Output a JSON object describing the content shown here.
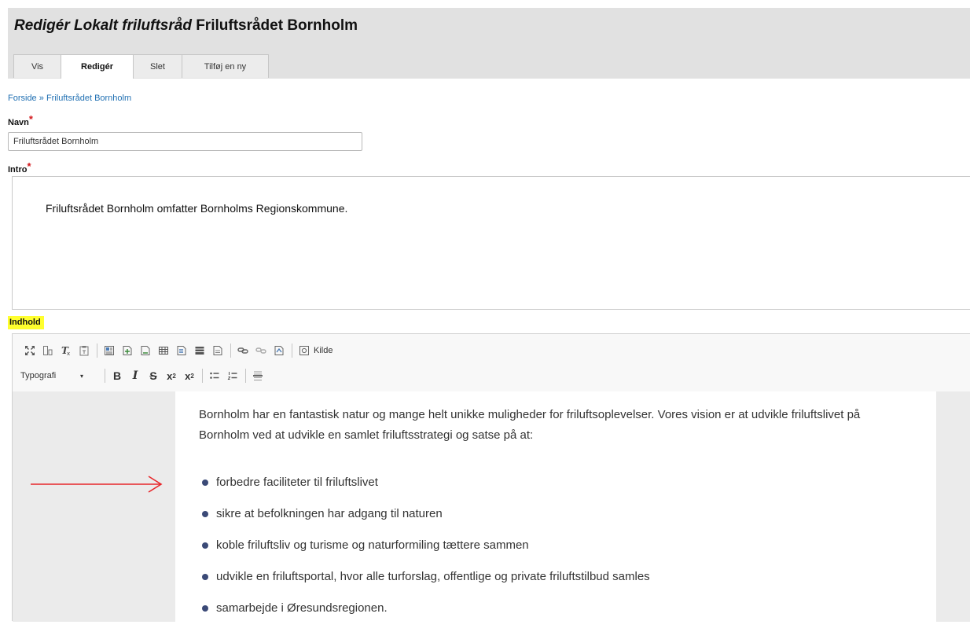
{
  "header": {
    "title_em": "Redigér Lokalt friluftsråd",
    "title_name": "Friluftsrådet Bornholm"
  },
  "tabs": [
    {
      "label": "Vis",
      "active": false
    },
    {
      "label": "Redigér",
      "active": true
    },
    {
      "label": "Slet",
      "active": false
    },
    {
      "label": "Tilføj en ny",
      "active": false
    }
  ],
  "breadcrumb": {
    "items": [
      "Forside",
      "Friluftsrådet Bornholm"
    ],
    "separator": "»"
  },
  "form": {
    "navn": {
      "label": "Navn",
      "required": "*",
      "value": "Friluftsrådet Bornholm"
    },
    "intro": {
      "label": "Intro",
      "required": "*",
      "text": "Friluftsrådet Bornholm omfatter Bornholms Regionskommune."
    },
    "indhold": {
      "label": "Indhold",
      "highlight_color": "#ffff2e"
    }
  },
  "toolbar": {
    "row1_icons": [
      "maximize-icon",
      "show-blocks-icon",
      "remove-format-icon",
      "paste-text-icon",
      "template-icon",
      "insert-after-icon",
      "insert-before-icon",
      "table-icon",
      "insert-row-icon",
      "block-icon",
      "document-icon",
      "link-icon",
      "unlink-icon",
      "anchor-icon",
      "source-icon"
    ],
    "source_label": "Kilde",
    "format_label": "Typografi",
    "format_arrow": "▾",
    "bold": "B",
    "italic": "I",
    "strike": "S",
    "superscript": "x",
    "subscript": "x",
    "row2_icons": [
      "bulleted-list-icon",
      "numbered-list-icon",
      "horizontal-rule-icon"
    ]
  },
  "content": {
    "paragraph": "Bornholm har en fantastisk natur og mange helt unikke muligheder for friluftsoplevelser. Vores vision er at udvikle friluftslivet på Bornholm ved at udvikle en samlet friluftsstrategi og satse på at:",
    "list": [
      "forbedre faciliteter til friluftslivet",
      "sikre at befolkningen har adgang til naturen",
      "koble friluftsliv og turisme og naturformiling tættere sammen",
      "udvikle en friluftsportal, hvor alle turforslag, offentlige og private friluftstilbud samles",
      "samarbejde i Øresundsregionen."
    ]
  },
  "colors": {
    "arrow": "#e8262a",
    "link": "#1f6fb2",
    "required": "#d3181c",
    "bullet": "#3b4a77"
  }
}
